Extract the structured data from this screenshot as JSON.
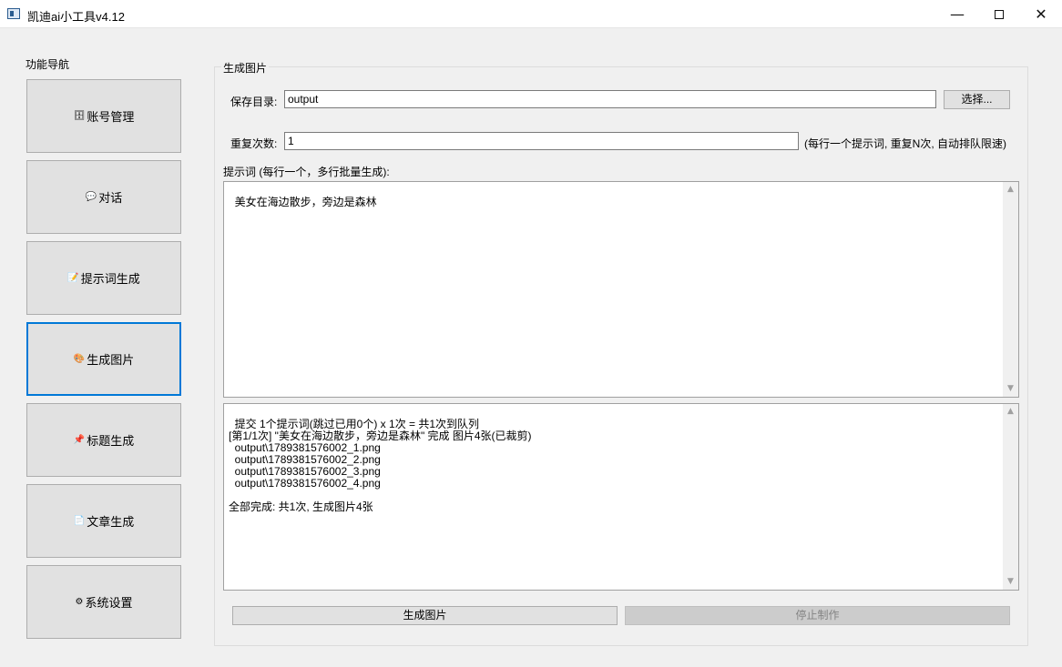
{
  "window": {
    "title": "凯迪ai小工具v4.12"
  },
  "nav": {
    "label": "功能导航",
    "items": [
      {
        "icon": "🗄",
        "label": "账号管理"
      },
      {
        "icon": "💬",
        "label": "对话"
      },
      {
        "icon": "📝",
        "label": "提示词生成"
      },
      {
        "icon": "🎨",
        "label": "生成图片"
      },
      {
        "icon": "📌",
        "label": "标题生成"
      },
      {
        "icon": "📄",
        "label": "文章生成"
      },
      {
        "icon": "⚙",
        "label": "系统设置"
      }
    ],
    "active": "生成图片"
  },
  "panel": {
    "title": "生成图片",
    "save_dir_label": "保存目录:",
    "save_dir_value": "output",
    "choose_label": "选择...",
    "repeat_label": "重复次数:",
    "repeat_value": "1",
    "repeat_hint": "(每行一个提示词, 重复N次, 自动排队限速)",
    "prompt_label": "提示词 (每行一个，多行批量生成):",
    "prompt_text": "美女在海边散步，旁边是森林",
    "log_text": "提交 1个提示词(跳过已用0个) x 1次 = 共1次到队列\n[第1/1次] \"美女在海边散步，旁边是森林\" 完成 图片4张(已裁剪)\n  output\\1789381576002_1.png\n  output\\1789381576002_2.png\n  output\\1789381576002_3.png\n  output\\1789381576002_4.png\n\n全部完成: 共1次, 生成图片4张",
    "generate_label": "生成图片",
    "stop_label": "停止制作"
  }
}
